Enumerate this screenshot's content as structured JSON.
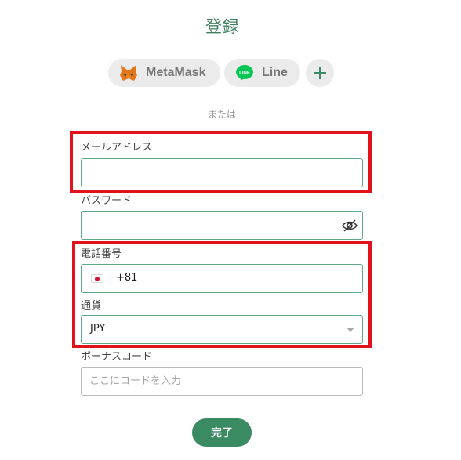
{
  "title": "登録",
  "social": {
    "metamask_label": "MetaMask",
    "line_label": "Line",
    "line_icon_text": "LINE"
  },
  "divider_text": "または",
  "email": {
    "label": "メールアドレス",
    "value": "",
    "placeholder": ""
  },
  "password": {
    "label": "パスワード",
    "value": "",
    "placeholder": ""
  },
  "phone": {
    "label": "電話番号",
    "dial_code": "+81",
    "value": ""
  },
  "currency": {
    "label": "通貨",
    "selected": "JPY"
  },
  "bonus_code": {
    "label": "ボーナスコード",
    "placeholder": "ここにコードを入力"
  },
  "submit_label": "完了",
  "colors": {
    "brand_green": "#3a8a62",
    "input_border": "#5daa88",
    "highlight_red": "#e0131c"
  }
}
